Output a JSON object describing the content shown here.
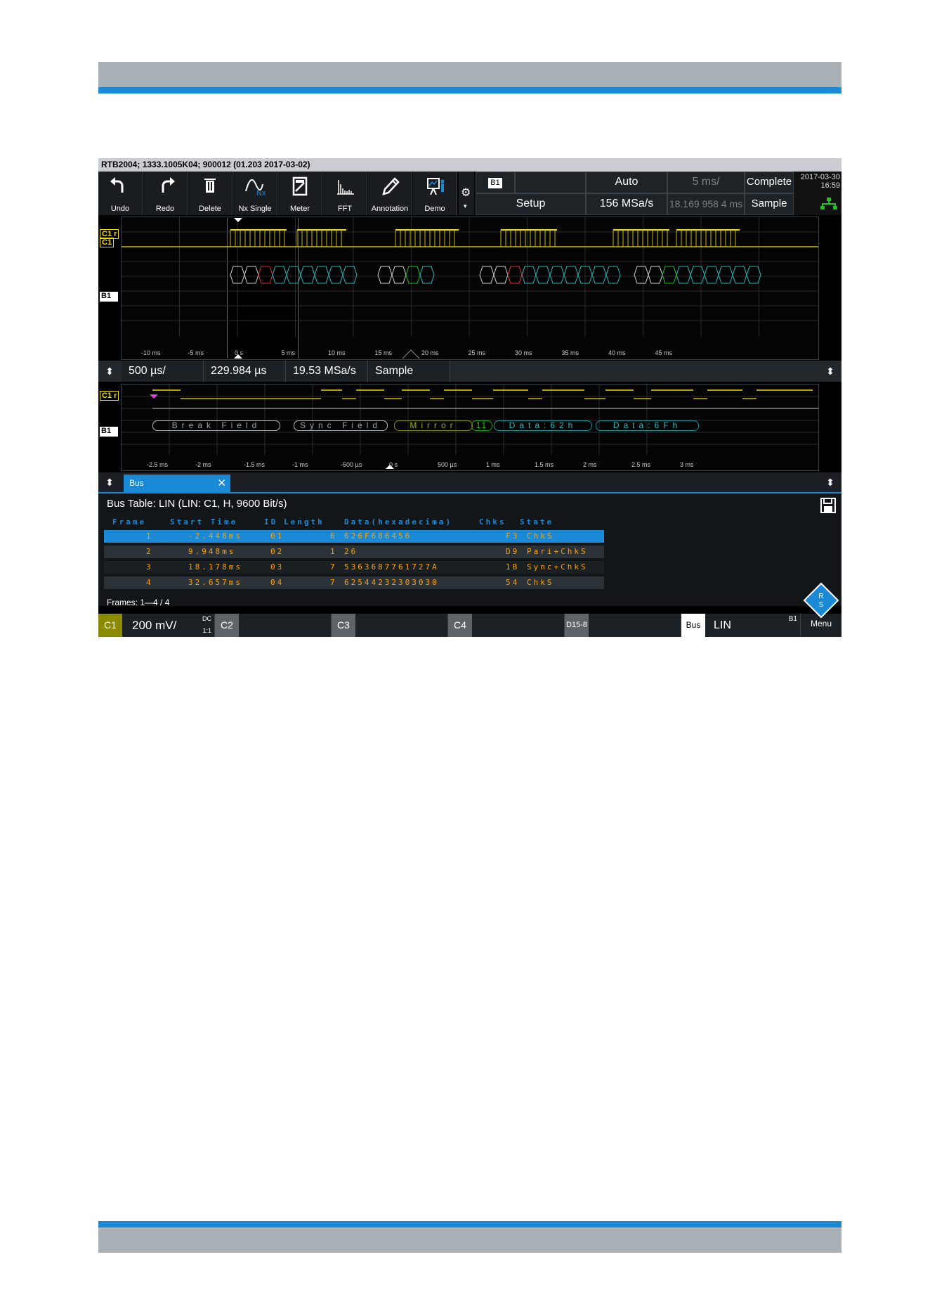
{
  "title_bar": "RTB2004; 1333.1005K04; 900012 (01.203 2017-03-02)",
  "toolbar": [
    {
      "label": "Undo",
      "icon": "undo-icon"
    },
    {
      "label": "Redo",
      "icon": "redo-icon"
    },
    {
      "label": "Delete",
      "icon": "delete-icon"
    },
    {
      "label": "Nx Single",
      "icon": "nx-single-icon"
    },
    {
      "label": "Meter",
      "icon": "meter-icon"
    },
    {
      "label": "FFT",
      "icon": "fft-icon"
    },
    {
      "label": "Annotation",
      "icon": "annotation-icon"
    },
    {
      "label": "Demo",
      "icon": "demo-icon"
    }
  ],
  "params": {
    "badge": "B1",
    "trigger_mode": "Auto",
    "time_scale": "5 ms/",
    "acq_state": "Complete",
    "setup": "Setup",
    "sample_rate": "156 MSa/s",
    "position": "18.169 958 4 ms",
    "acq_mode": "Sample"
  },
  "clock": {
    "date": "2017-03-30",
    "time": "16:59"
  },
  "overview": {
    "tags": {
      "c1r": "C1 r",
      "c1": "C1",
      "b1": "B1"
    },
    "ticks": [
      "-10 ms",
      "-5 ms",
      "0 s",
      "5 ms",
      "10 ms",
      "15 ms",
      "20 ms",
      "25 ms",
      "30 ms",
      "35 ms",
      "40 ms",
      "45 ms"
    ]
  },
  "zoom_bar": {
    "time_div": "500 µs/",
    "position": "229.984 µs",
    "sample_rate": "19.53 MSa/s",
    "mode": "Sample"
  },
  "zoom_wave": {
    "tags": {
      "c1": "C1 r",
      "b1": "B1"
    },
    "frames": [
      "Break Field",
      "Sync Field",
      "Mirror",
      "11",
      "Data:62h",
      "Data:6Fh"
    ],
    "ticks": [
      "-2.5 ms",
      "-2 ms",
      "-1.5 ms",
      "-1 ms",
      "-500 µs",
      "0 s",
      "500 µs",
      "1 ms",
      "1.5 ms",
      "2 ms",
      "2.5 ms",
      "3 ms"
    ]
  },
  "tab": {
    "label": "Bus"
  },
  "bus_table": {
    "title": "Bus Table: LIN (LIN: C1, H, 9600 Bit/s)",
    "headers": [
      "Frame",
      "Start Time",
      "ID",
      "Length",
      "Data(hexadecima)",
      "Chks",
      "State"
    ],
    "rows": [
      {
        "frame": "1",
        "start": "-2.448ms",
        "id": "01",
        "length": "6",
        "data": "626F686456",
        "chks": "F3",
        "state": "ChkS"
      },
      {
        "frame": "2",
        "start": "9.948ms",
        "id": "02",
        "length": "1",
        "data": "26",
        "chks": "D9",
        "state": "Pari+ChkS"
      },
      {
        "frame": "3",
        "start": "18.178ms",
        "id": "03",
        "length": "7",
        "data": "5363687761727A",
        "chks": "1B",
        "state": "Sync+ChkS"
      },
      {
        "frame": "4",
        "start": "32.657ms",
        "id": "04",
        "length": "7",
        "data": "62544232303030",
        "chks": "54",
        "state": "ChkS"
      }
    ],
    "frames_label": "Frames: 1—4 / 4"
  },
  "bottom": {
    "c1": "C1",
    "c1_scale": "200 mV/",
    "coupling": "DC",
    "ratio": "1:1",
    "c2": "C2",
    "c3": "C3",
    "c4": "C4",
    "digital": "D15-8",
    "bus": "Bus",
    "bus_proto": "LIN",
    "bus_id": "B1",
    "menu": "Menu"
  },
  "colors": {
    "accent": "#1a8ad6",
    "channel1": "#f0e000",
    "table_text": "#ffa000",
    "data_frames": "#2bb8b8"
  }
}
